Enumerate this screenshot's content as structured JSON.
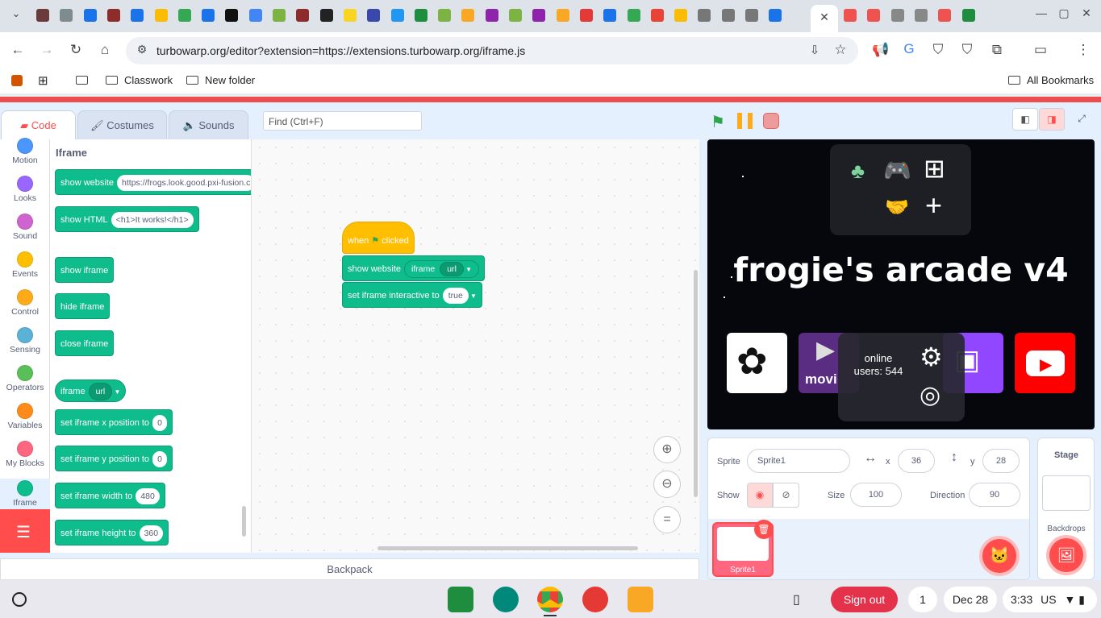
{
  "browser": {
    "url": "turbowarp.org/editor?extension=https://extensions.turbowarp.org/iframe.js",
    "bookmarks": [
      "Classwork",
      "New folder"
    ],
    "all_bookmarks": "All Bookmarks"
  },
  "editor": {
    "tabs": [
      "Code",
      "Costumes",
      "Sounds"
    ],
    "find_placeholder": "Find (Ctrl+F)",
    "categories": [
      {
        "label": "Motion",
        "color": "#4c97ff"
      },
      {
        "label": "Looks",
        "color": "#9966ff"
      },
      {
        "label": "Sound",
        "color": "#cf63cf"
      },
      {
        "label": "Events",
        "color": "#ffbf00"
      },
      {
        "label": "Control",
        "color": "#ffab19"
      },
      {
        "label": "Sensing",
        "color": "#5cb1d6"
      },
      {
        "label": "Operators",
        "color": "#59c059"
      },
      {
        "label": "Variables",
        "color": "#ff8c1a"
      },
      {
        "label": "My Blocks",
        "color": "#ff6680"
      },
      {
        "label": "Iframe",
        "color": "#0fbd8c"
      }
    ],
    "palette": {
      "heading": "Iframe",
      "show_website": "show website",
      "show_website_arg": "https://frogs.look.good.pxi-fusion.c",
      "show_html": "show HTML",
      "show_html_arg": "<h1>It works!</h1>",
      "show_iframe": "show iframe",
      "hide_iframe": "hide iframe",
      "close_iframe": "close iframe",
      "iframe_reporter": "iframe",
      "iframe_reporter_dd": "url",
      "set_x": "set iframe x position to",
      "set_x_val": "0",
      "set_y": "set iframe y position to",
      "set_y_val": "0",
      "set_w": "set iframe width to",
      "set_w_val": "480",
      "set_h": "set iframe height to",
      "set_h_val": "360"
    },
    "script": {
      "hat_when": "when",
      "hat_clicked": "clicked",
      "show_website": "show website",
      "iframe": "iframe",
      "url": "url",
      "set_interactive": "set iframe interactive to",
      "true": "true"
    },
    "zoom_reset": "="
  },
  "backpack": "Backpack",
  "stage": {
    "title": "frogie's arcade v4",
    "tile_text": "movi",
    "online_line1": "online",
    "online_line2": "users: 544"
  },
  "sprite_info": {
    "sprite_label": "Sprite",
    "sprite_name": "Sprite1",
    "x_label": "x",
    "x": "36",
    "y_label": "y",
    "y": "28",
    "show_label": "Show",
    "size_label": "Size",
    "size": "100",
    "direction_label": "Direction",
    "direction": "90",
    "thumb_name": "Sprite1"
  },
  "stage_pane": {
    "title": "Stage",
    "backdrops": "Backdrops"
  },
  "taskbar": {
    "sign_out": "Sign out",
    "notif": "1",
    "date": "Dec 28",
    "time": "3:33",
    "locale": "US"
  }
}
